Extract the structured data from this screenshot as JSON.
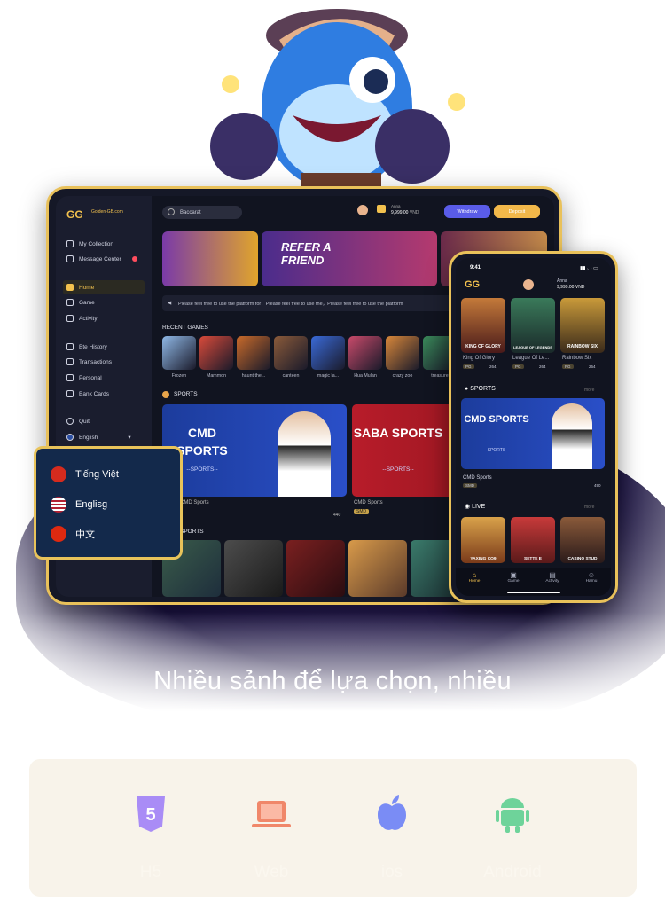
{
  "tagline": "Nhiều sảnh để lựa chọn, nhiều",
  "tablet": {
    "logo": "GG",
    "logo_site": "Golden-GB.com",
    "search_value": "Baccarat",
    "user_name": "Anna",
    "balance": "9,999.00",
    "currency": "VND",
    "withdraw_label": "Withdraw",
    "deposit_label": "Deposit",
    "sidebar": {
      "items": [
        {
          "label": "My Collection"
        },
        {
          "label": "Message Center"
        },
        {
          "label": "Home"
        },
        {
          "label": "Game"
        },
        {
          "label": "Activity"
        },
        {
          "label": "Bte History"
        },
        {
          "label": "Transactions"
        },
        {
          "label": "Personal"
        },
        {
          "label": "Bank Cards"
        },
        {
          "label": "Quit"
        },
        {
          "label": "English"
        }
      ]
    },
    "banner_refer": "REFER A FRIEND",
    "notice": "Please feel free to use the platform for，Please feel free to use the，Please feel free to use the platform",
    "recent_games_title": "RECENT GAMES",
    "recent_games": [
      "Frozen",
      "Mammon",
      "haunt the...",
      "canteen",
      "magic la...",
      "Hua Mulan",
      "crazy zoo",
      "treasure"
    ],
    "sports_title": "SPORTS",
    "sports": [
      {
        "title": "CMD SPORTS",
        "sub": "--SPORTS--",
        "caption": "CMD Sports",
        "count": "440"
      },
      {
        "title": "SABA SPORTS",
        "sub": "--SPORTS--",
        "caption": "CMD Sports",
        "tag": "SMD"
      }
    ],
    "esports_title": "SPORTS"
  },
  "language_menu": {
    "items": [
      {
        "label": "Tiếng Việt",
        "flag_color": "#d52b1e"
      },
      {
        "label": "Englisg",
        "flag_color": "#2b4fa3"
      },
      {
        "label": "中文",
        "flag_color": "#de2910"
      }
    ]
  },
  "phone": {
    "time": "9:41",
    "logo": "GG",
    "user_name": "Anna",
    "balance": "9,999.00",
    "currency": "VND",
    "games": [
      {
        "title": "KING OF GLORY",
        "caption": "King Of Glory",
        "tag": "PG",
        "count": "264"
      },
      {
        "title": "LEAGUE OF LEGENDS",
        "caption": "League Of Le...",
        "tag": "PG",
        "count": "264"
      },
      {
        "title": "RAINBOW SIX",
        "caption": "Rainbow Six",
        "tag": "PG",
        "count": "264"
      }
    ],
    "sports_title": "SPORTS",
    "more": "more",
    "sports_card": {
      "title": "CMD SPORTS",
      "sub": "--SPORTS--",
      "caption": "CMD Sports",
      "tag": "SMD",
      "count": "490"
    },
    "live_title": "LIVE",
    "live": [
      "YAXING CQ9",
      "SETTE E",
      "CASINO STUD"
    ],
    "nav": [
      "Home",
      "Game",
      "Activity",
      "Hamu"
    ]
  },
  "platforms": [
    {
      "label": "H5",
      "icon": "html5-icon",
      "color": "#a98cf6"
    },
    {
      "label": "Web",
      "icon": "laptop-icon",
      "color": "#f0876a"
    },
    {
      "label": "ios",
      "icon": "apple-icon",
      "color": "#7a8cf5"
    },
    {
      "label": "Android",
      "icon": "android-icon",
      "color": "#6ed39a"
    }
  ]
}
